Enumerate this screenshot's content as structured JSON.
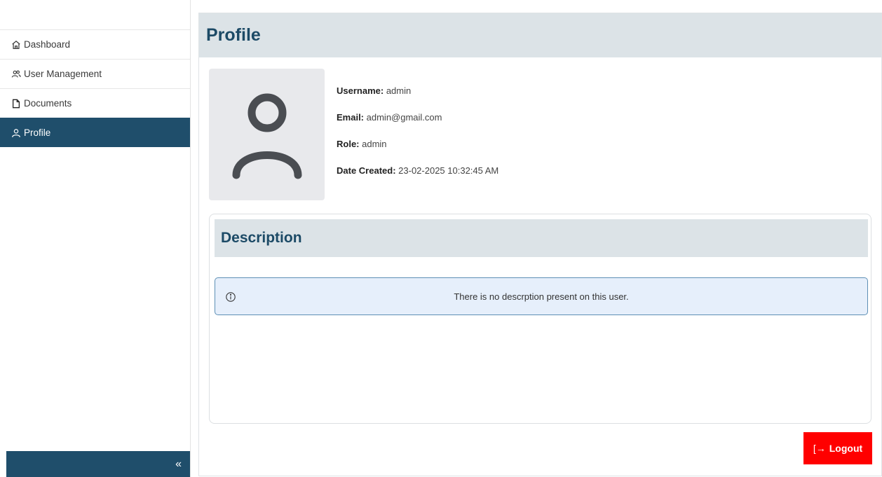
{
  "sidebar": {
    "items": [
      {
        "label": "Dashboard",
        "icon": "home-icon"
      },
      {
        "label": "User Management",
        "icon": "users-icon"
      },
      {
        "label": "Documents",
        "icon": "document-icon"
      },
      {
        "label": "Profile",
        "icon": "user-icon",
        "active": true
      }
    ],
    "collapse_glyph": "«",
    "active_color": "#1f4e6b"
  },
  "page": {
    "title": "Profile"
  },
  "profile": {
    "username_label": "Username:",
    "username": "admin",
    "email_label": "Email:",
    "email": "admin@gmail.com",
    "role_label": "Role:",
    "role": "admin",
    "date_label": "Date Created:",
    "date": "23-02-2025 10:32:45 AM"
  },
  "description": {
    "title": "Description",
    "empty_message": "There is no descrption present on this user."
  },
  "actions": {
    "logout_label": "Logout",
    "logout_color": "#ff0000"
  }
}
